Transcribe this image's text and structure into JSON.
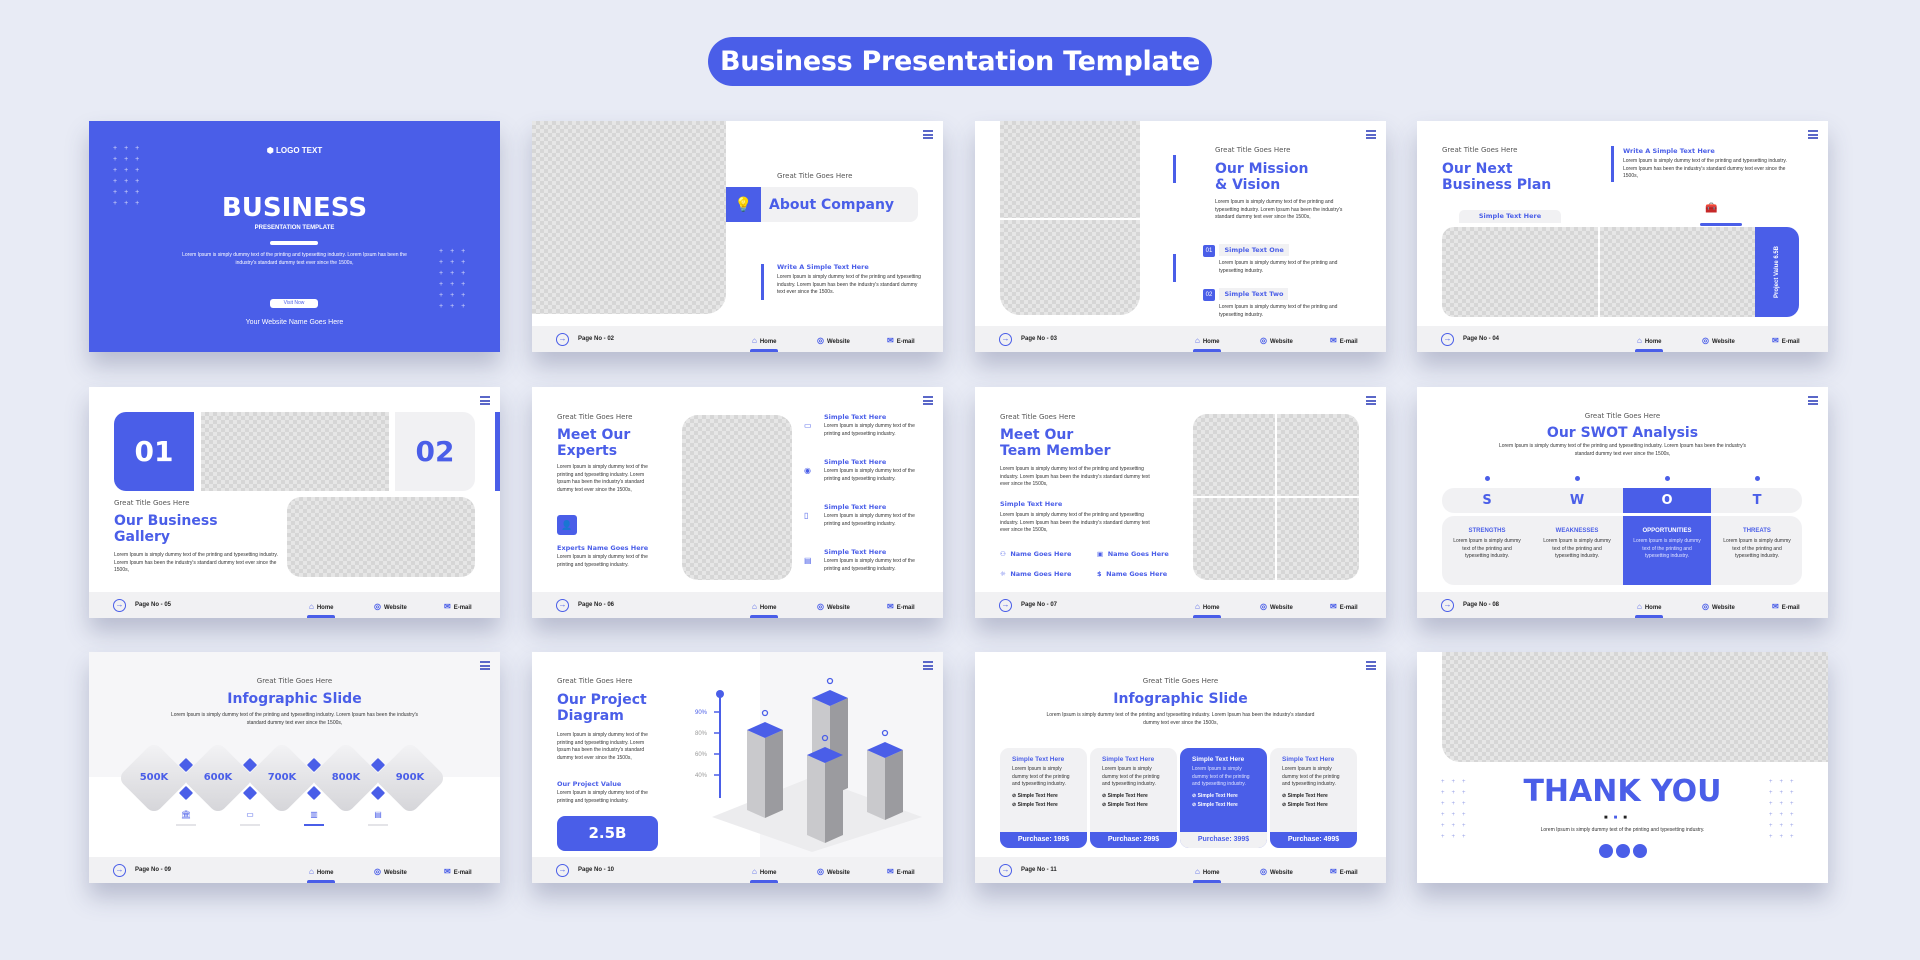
{
  "page_title": "Business Presentation Template",
  "colors": {
    "accent": "#4a5ee8",
    "background": "#e8ebf5",
    "footer": "#f1f1f3"
  },
  "common": {
    "kicker": "Great Title Goes Here",
    "lorem_long": "Lorem Ipsum is simply dummy text of the printing and typesetting industry. Lorem Ipsum has been the industry's standard dummy text ever since the 1500s,",
    "lorem_short": "Lorem Ipsum is simply dummy text of the printing and typesetting industry.",
    "simple_text": "Simple Text Here",
    "footer": {
      "home": "Home",
      "website": "Website",
      "email": "E-mail"
    }
  },
  "slides": [
    {
      "page": "",
      "logo": "LOGO TEXT",
      "title": "BUSINESS",
      "subtitle": "PRESENTATION TEMPLATE",
      "body": "Lorem Ipsum is simply dummy text of the printing and typesetting industry. Lorem Ipsum has been the industry's standard dummy text ever since the 1500s,",
      "button": "Visit Now",
      "website": "Your Website Name Goes Here"
    },
    {
      "page": "Page No - 02",
      "title": "About Company",
      "sub": "Write A Simple Text Here",
      "body": "Lorem Ipsum is simply dummy text of the printing and typesetting industry. Lorem Ipsum has been the industry's standard dummy text ever since the 1500s."
    },
    {
      "page": "Page No - 03",
      "title1": "Our Mission",
      "title2": "& Vision",
      "items": [
        {
          "num": "01",
          "label": "Simple Text One"
        },
        {
          "num": "02",
          "label": "Simple Text Two"
        }
      ]
    },
    {
      "page": "Page No - 04",
      "title1": "Our Next",
      "title2": "Business Plan",
      "sub": "Write A Simple Text Here",
      "tab": "Simple Text Here",
      "value": "Project Value 6.5B"
    },
    {
      "page": "Page No - 05",
      "num1": "01",
      "num2": "02",
      "title1": "Our Business",
      "title2": "Gallery"
    },
    {
      "page": "Page No - 06",
      "title1": "Meet Our",
      "title2": "Experts",
      "expert": "Experts Name Goes Here",
      "items": [
        "Simple Text Here",
        "Simple Text Here",
        "Simple Text Here",
        "Simple Text Here"
      ]
    },
    {
      "page": "Page No - 07",
      "title1": "Meet Our",
      "title2": "Team Member",
      "sub": "Simple Text Here",
      "names": [
        "Name Goes Here",
        "Name Goes Here",
        "Name Goes Here",
        "Name Goes Here"
      ]
    },
    {
      "page": "Page No - 08",
      "title": "Our SWOT Analysis",
      "letters": [
        "S",
        "W",
        "O",
        "T"
      ],
      "labels": [
        "STRENGTHS",
        "WEAKNESSES",
        "OPPORTUNITIES",
        "THREATS"
      ],
      "body": "Lorem Ipsum is simply dummy text of the printing and typesetting industry."
    },
    {
      "page": "Page No - 09",
      "title": "Infographic Slide",
      "values": [
        "500K",
        "600K",
        "700K",
        "800K",
        "900K"
      ]
    },
    {
      "page": "Page No - 10",
      "title1": "Our Project",
      "title2": "Diagram",
      "sub": "Our Project Value",
      "value": "2.5B",
      "axis": [
        "90%",
        "80%",
        "60%",
        "40%"
      ]
    },
    {
      "page": "Page No - 11",
      "title": "Infographic Slide",
      "plans": [
        {
          "title": "Simple Text Here",
          "price": "Purchase: 199$"
        },
        {
          "title": "Simple Text Here",
          "price": "Purchase: 299$"
        },
        {
          "title": "Simple Text Here",
          "price": "Purchase: 399$"
        },
        {
          "title": "Simple Text Here",
          "price": "Purchase: 499$"
        }
      ],
      "check": "Simple Text Here"
    },
    {
      "page": "",
      "title": "THANK YOU",
      "body": "Lorem Ipsum is simply dummy text of the printing and typesetting industry."
    }
  ]
}
